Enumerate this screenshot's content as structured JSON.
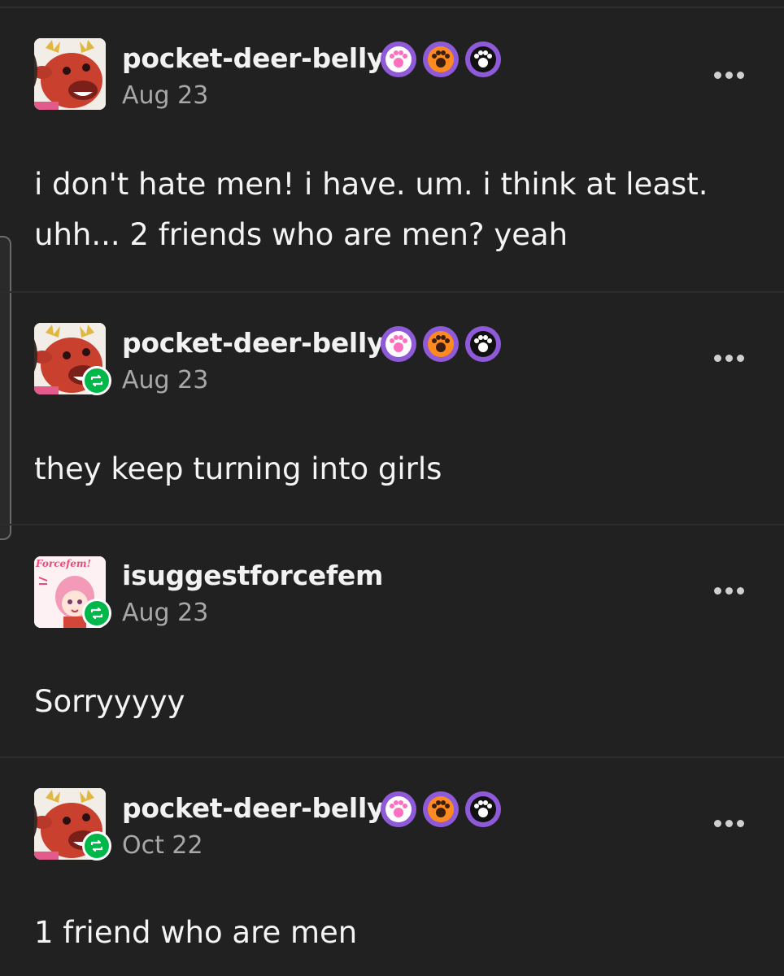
{
  "posts": [
    {
      "username": "pocket-deer-belly",
      "date": "Aug 23",
      "text_lines": [
        "i don't hate men! i have. um. i think at least.",
        "uhh... 2 friends who are men? yeah"
      ],
      "reblogged": false,
      "badges": [
        "pink-paw-badge",
        "orange-paw-badge",
        "black-paw-badge"
      ]
    },
    {
      "username": "pocket-deer-belly",
      "date": "Aug 23",
      "text_lines": [
        "they keep turning into girls"
      ],
      "reblogged": true,
      "badges": [
        "pink-paw-badge",
        "orange-paw-badge",
        "black-paw-badge"
      ]
    },
    {
      "username": "isuggestforcefem",
      "date": "Aug 23",
      "text_lines": [
        "Sorryyyyy"
      ],
      "reblogged": true,
      "badges": [],
      "avatar_text": "Forcefem!"
    },
    {
      "username": "pocket-deer-belly",
      "date": "Oct 22",
      "text_lines": [
        "1 friend who are men"
      ],
      "reblogged": true,
      "badges": [
        "pink-paw-badge",
        "orange-paw-badge",
        "black-paw-badge"
      ]
    }
  ],
  "colors": {
    "background": "#212121",
    "badge_ring": "#8e5ad8",
    "reblog_green": "#00b84a",
    "date_gray": "#a8a8a8"
  }
}
